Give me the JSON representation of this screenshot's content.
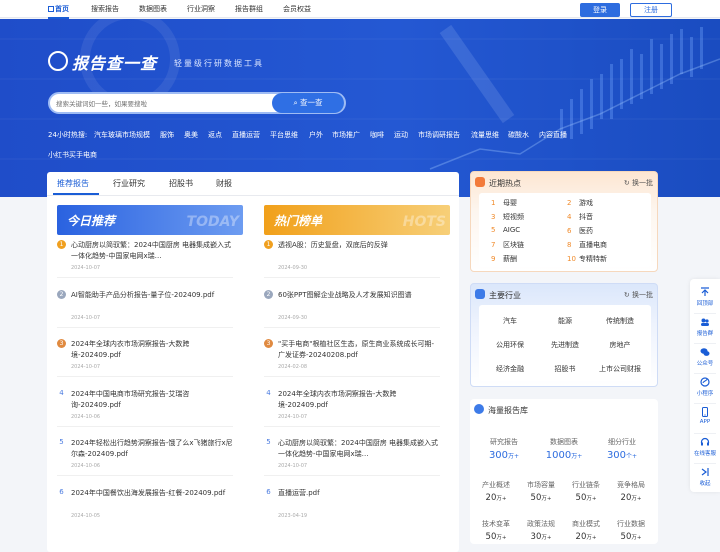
{
  "nav": {
    "items": [
      {
        "label": "首页",
        "active": true
      },
      {
        "label": "搜索报告"
      },
      {
        "label": "数据图表"
      },
      {
        "label": "行业洞察"
      },
      {
        "label": "报告群组"
      },
      {
        "label": "会员权益"
      }
    ],
    "login": "登录",
    "register": "注册"
  },
  "hero": {
    "logo_title": "报告查一查",
    "logo_sub": "轻量级行研数据工具",
    "search_placeholder": "搜索关键词如一些，如果要搜啦",
    "search_button": "查一查",
    "hot_label": "24小时热搜:",
    "hot_words": [
      "汽车玻璃市场规模",
      "服饰",
      "奥美",
      "返点",
      "直播运营",
      "平台思维",
      "户外",
      "市场推广",
      "咖啡",
      "运动",
      "市场调研报告",
      "流量思维",
      "碳酸水",
      "内容直播",
      "小红书买手电商"
    ]
  },
  "tabs": [
    "推荐报告",
    "行业研究",
    "招股书",
    "财报"
  ],
  "banners": {
    "left": {
      "title": "今日推荐",
      "en": "TODAY"
    },
    "right": {
      "title": "热门榜单",
      "en": "HOTS"
    }
  },
  "recommend": [
    {
      "rank": "1",
      "title": "心动厨房以简驭繁：2024中国厨房 电器集成嵌入式一体化趋势-中国家电网x瑞…",
      "date": "2024-10-07"
    },
    {
      "rank": "2",
      "title": "AI智能助手产品分析报告-量子位-202409.pdf",
      "date": "2024-10-07"
    },
    {
      "rank": "3",
      "title": "2024年全球内衣市场洞察报告-大数跨境-202409.pdf",
      "date": "2024-10-07"
    },
    {
      "rank": "4",
      "title": "2024年中国电商市场研究报告-艾瑞咨询-202409.pdf",
      "date": "2024-10-06"
    },
    {
      "rank": "5",
      "title": "2024年轻松出行趋势洞察报告-饿了么x飞猪旅行x尼尔森-202409.pdf",
      "date": "2024-10-06"
    },
    {
      "rank": "6",
      "title": "2024年中国餐饮出海发展报告-红餐-202409.pdf",
      "date": "2024-10-05"
    }
  ],
  "hots": [
    {
      "rank": "1",
      "title": "透视A股：历史复盘，双底后的反弹",
      "date": "2024-09-30"
    },
    {
      "rank": "2",
      "title": "60张PPT图解企业战略及人才发展知识图谱",
      "date": "2024-09-30"
    },
    {
      "rank": "3",
      "title": "\"买手电商\"根植社区生态，原生商业系统成长可期-广发证券-20240208.pdf",
      "date": "2024-02-08"
    },
    {
      "rank": "4",
      "title": "2024年全球内衣市场洞察报告-大数跨境-202409.pdf",
      "date": "2024-10-07"
    },
    {
      "rank": "5",
      "title": "心动厨房以简驭繁：2024中国厨房 电器集成嵌入式一体化趋势-中国家电网x瑞…",
      "date": "2024-10-07"
    },
    {
      "rank": "6",
      "title": "直播运营.pdf",
      "date": "2023-04-19"
    }
  ],
  "hot_card": {
    "title": "近期热点",
    "refresh": "换一批",
    "left": [
      {
        "n": "1",
        "w": "母婴"
      },
      {
        "n": "3",
        "w": "短视频"
      },
      {
        "n": "5",
        "w": "AIGC"
      },
      {
        "n": "7",
        "w": "区块链"
      },
      {
        "n": "9",
        "w": "薪酬"
      }
    ],
    "right": [
      {
        "n": "2",
        "w": "游戏"
      },
      {
        "n": "4",
        "w": "抖音"
      },
      {
        "n": "6",
        "w": "医药"
      },
      {
        "n": "8",
        "w": "直播电商"
      },
      {
        "n": "10",
        "w": "专精特新"
      }
    ]
  },
  "industry_card": {
    "title": "主要行业",
    "refresh": "换一批",
    "items": [
      "汽车",
      "能源",
      "传统制造",
      "公用环保",
      "先进制造",
      "房地产",
      "经济金融",
      "招股书",
      "上市公司财报"
    ]
  },
  "stats": {
    "title": "海量报告库",
    "main": [
      {
        "label": "研究报告",
        "value": "300",
        "unit": "万+"
      },
      {
        "label": "数据图表",
        "value": "1000",
        "unit": "万+"
      },
      {
        "label": "细分行业",
        "value": "300",
        "unit": "个+"
      }
    ],
    "sub": [
      {
        "label": "产业概述",
        "value": "20",
        "unit": "万+"
      },
      {
        "label": "市场容量",
        "value": "50",
        "unit": "万+"
      },
      {
        "label": "行业链条",
        "value": "50",
        "unit": "万+"
      },
      {
        "label": "竞争格局",
        "value": "20",
        "unit": "万+"
      },
      {
        "label": "技术变革",
        "value": "50",
        "unit": "万+"
      },
      {
        "label": "政策法规",
        "value": "30",
        "unit": "万+"
      },
      {
        "label": "商业模式",
        "value": "20",
        "unit": "万+"
      },
      {
        "label": "行业数据",
        "value": "50",
        "unit": "万+"
      }
    ]
  },
  "sidebar": [
    "回顶部",
    "报告群",
    "公众号",
    "小程序",
    "APP",
    "在线客服",
    "收起"
  ],
  "colors": {
    "brand": "#2d6cdf",
    "hero": "#2458d3",
    "orange": "#f0a020"
  }
}
